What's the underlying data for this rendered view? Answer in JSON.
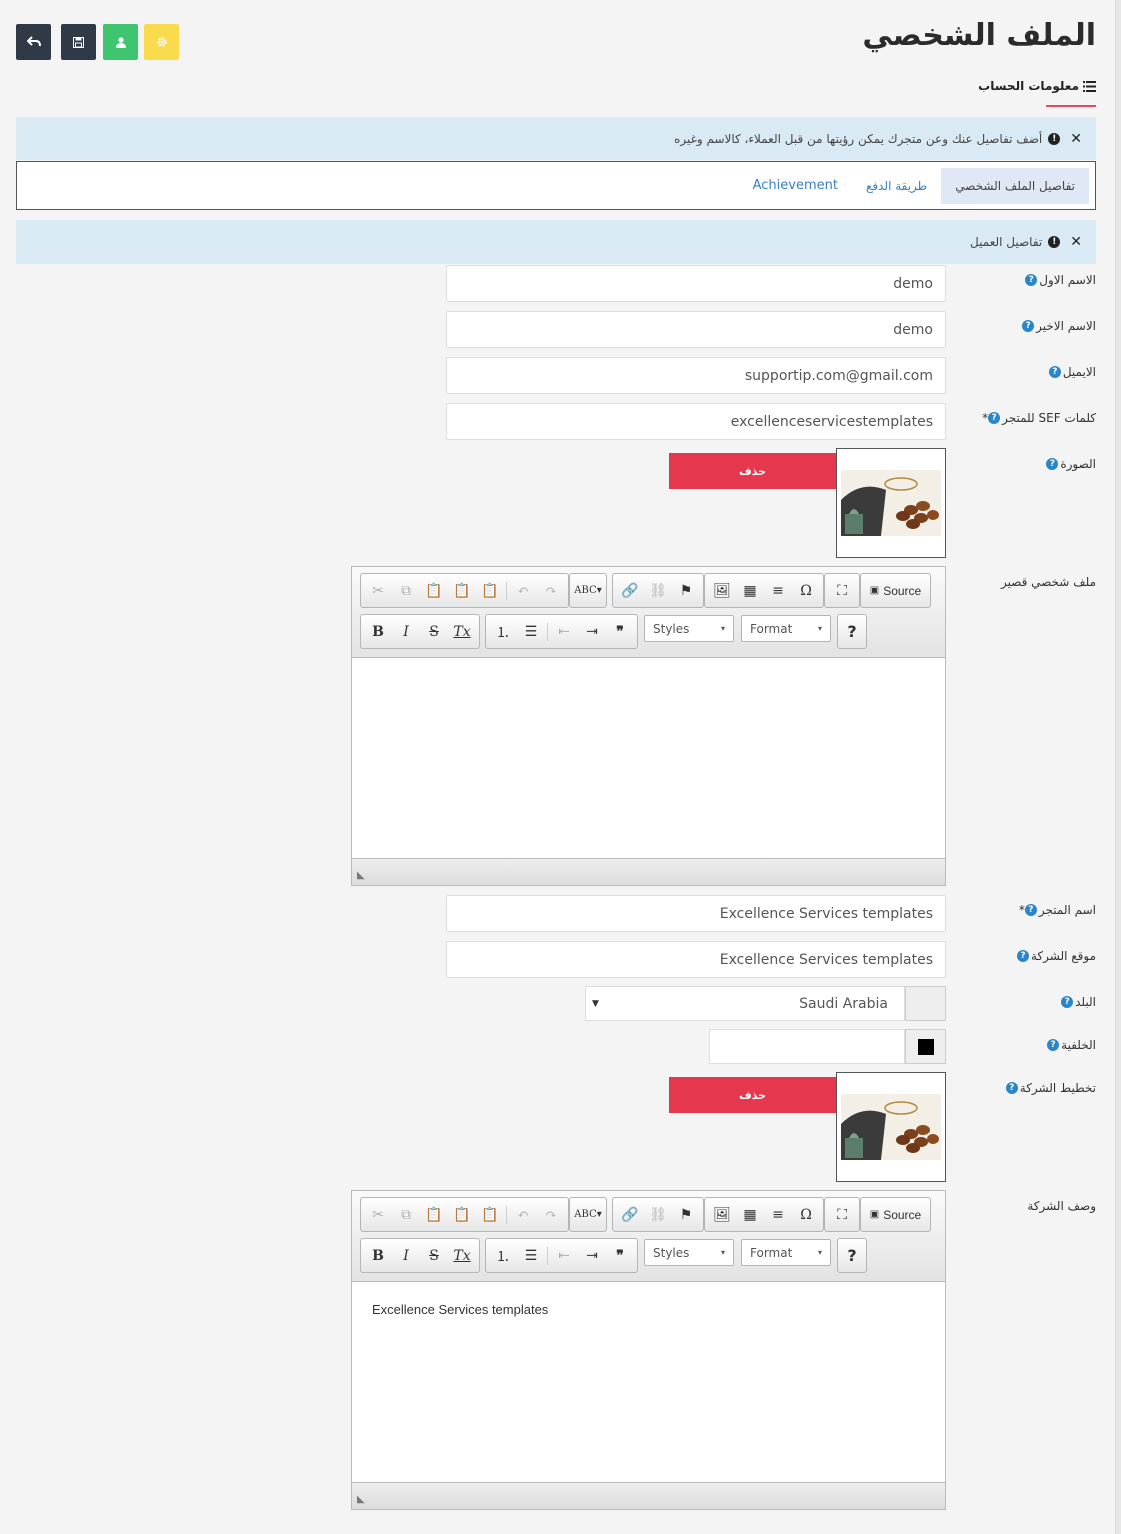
{
  "page": {
    "title": "الملف الشخصي"
  },
  "actions": {
    "back": "back-icon",
    "save": "save-icon",
    "user": "user-icon",
    "settings": "gear-icon"
  },
  "section": {
    "heading": "معلومات الحساب"
  },
  "alerts": {
    "profile_tip": "أضف تفاصيل عنك وعن متجرك يمكن رؤيتها من قبل العملاء، كالاسم وغيره",
    "customer_details": "تفاصيل العميل"
  },
  "tabs": [
    {
      "label": "تفاصيل الملف الشخصي"
    },
    {
      "label": "طريقة الدفع"
    },
    {
      "label": "Achievement"
    }
  ],
  "form": {
    "first_name": {
      "label": "الاسم الاول",
      "value": "demo"
    },
    "last_name": {
      "label": "الاسم الاخير",
      "value": "demo"
    },
    "email": {
      "label": "الايميل",
      "value": "supportip.com@gmail.com"
    },
    "sef": {
      "label": "كلمات SEF للمتجر",
      "value": "excellenceservicestemplates"
    },
    "image": {
      "label": "الصورة",
      "delete": "حذف"
    },
    "short_bio": {
      "label": "ملف شخصي قصير",
      "content": ""
    },
    "store_name": {
      "label": "اسم المتجر",
      "value": "Excellence Services templates"
    },
    "company_site": {
      "label": "موقع الشركة",
      "value": "Excellence Services templates"
    },
    "country": {
      "label": "البلد",
      "value": "Saudi Arabia"
    },
    "background": {
      "label": "الخلفية",
      "color": "#000000"
    },
    "company_logo": {
      "label": "تخطيط الشركة",
      "delete": "حذف"
    },
    "company_desc": {
      "label": "وصف الشركة",
      "content": "Excellence Services templates"
    }
  },
  "editor": {
    "source": "Source",
    "styles": "Styles",
    "format": "Format",
    "help": "?"
  },
  "colors": {
    "accent": "#e8485f",
    "dark_button": "#2f3a46",
    "green_button": "#3fc56f",
    "yellow_button": "#fadb4e",
    "alert_bg": "#d9eaf4",
    "delete": "#e5384f"
  }
}
